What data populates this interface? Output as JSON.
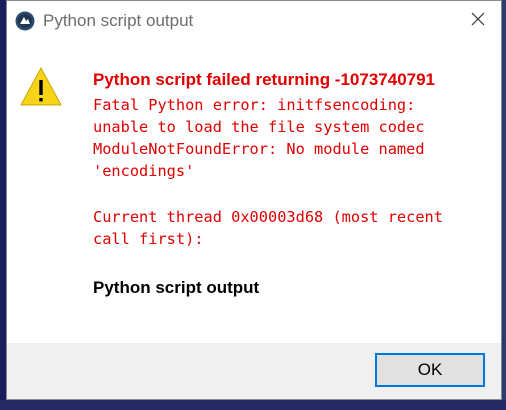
{
  "window": {
    "title": "Python script output",
    "app_icon": "python-app-icon",
    "close_icon": "close-icon"
  },
  "message": {
    "icon": "warning-icon",
    "heading": "Python script failed returning -1073740791",
    "error_lines": [
      "Fatal Python error: initfsencoding:",
      "unable to load the file system codec",
      "ModuleNotFoundError: No module named",
      "'encodings'"
    ],
    "thread_lines": [
      "Current thread 0x00003d68 (most recent",
      "call first):"
    ],
    "output_label": "Python script output"
  },
  "footer": {
    "ok_label": "OK"
  },
  "colors": {
    "error_text": "#e00000",
    "accent": "#0078d7",
    "warning_yellow": "#f7d417"
  }
}
